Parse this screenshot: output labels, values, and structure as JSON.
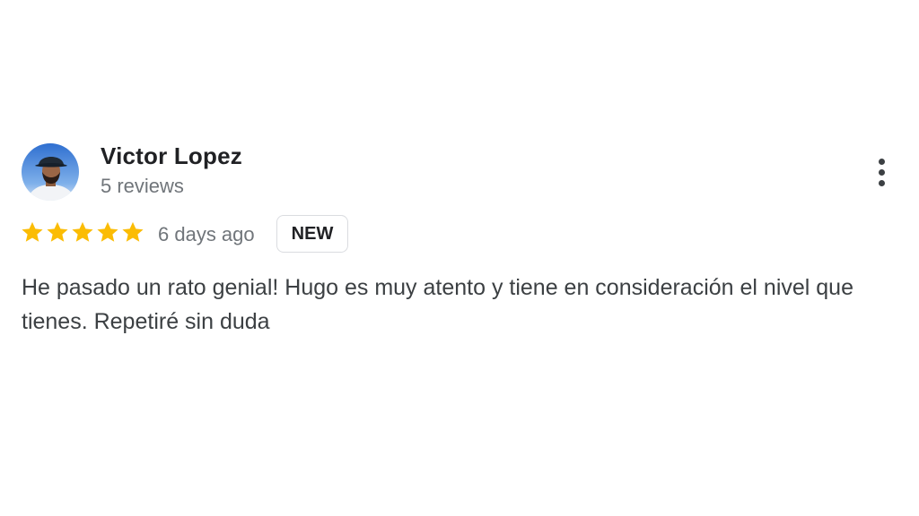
{
  "review": {
    "author_name": "Victor Lopez",
    "review_count": "5 reviews",
    "rating": 5,
    "rating_max": 5,
    "date": "6 days ago",
    "badge": "NEW",
    "text": "He pasado un rato genial! Hugo es muy atento y tiene en consideración el nivel que tienes. Repetiré sin duda"
  },
  "icons": {
    "star": "star-icon",
    "more": "more-vert-icon"
  },
  "colors": {
    "star": "#fbbc04",
    "name": "#202124",
    "secondary": "#70757a",
    "body": "#3c4043"
  }
}
